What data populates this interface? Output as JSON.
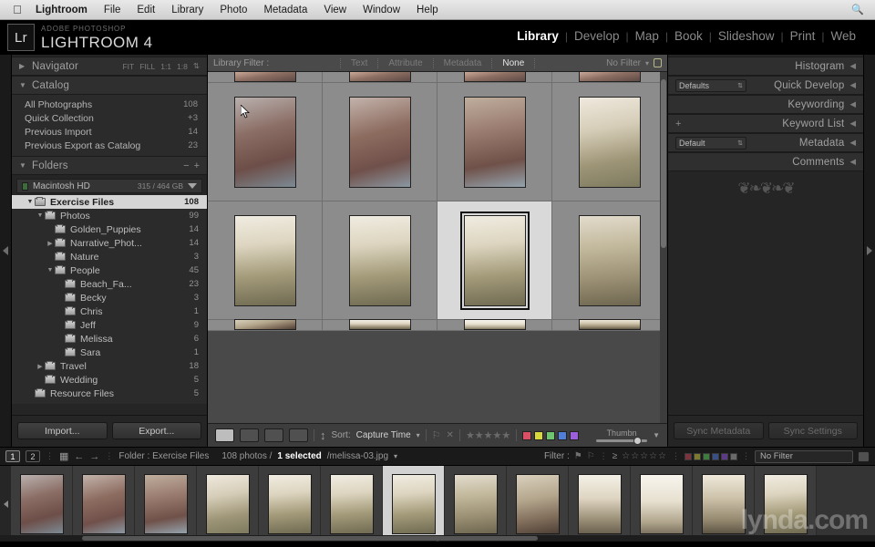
{
  "menubar": {
    "apple": "apple-logo",
    "items": [
      "Lightroom",
      "File",
      "Edit",
      "Library",
      "Photo",
      "Metadata",
      "View",
      "Window",
      "Help"
    ],
    "search": "search-icon"
  },
  "identity": {
    "badge": "Lr",
    "small": "ADOBE PHOTOSHOP",
    "large": "LIGHTROOM 4"
  },
  "modules": {
    "items": [
      "Library",
      "Develop",
      "Map",
      "Book",
      "Slideshow",
      "Print",
      "Web"
    ],
    "active": "Library",
    "separator": "|"
  },
  "left_panel": {
    "navigator": {
      "title": "Navigator",
      "twist": "▶",
      "zoom_options": [
        "FIT",
        "FILL",
        "1:1",
        "1:8"
      ]
    },
    "catalog": {
      "title": "Catalog",
      "twist": "▼",
      "items": [
        {
          "label": "All Photographs",
          "count": "108"
        },
        {
          "label": "Quick Collection",
          "count": "3",
          "plus": "+"
        },
        {
          "label": "Previous Import",
          "count": "14"
        },
        {
          "label": "Previous Export as Catalog",
          "count": "23"
        }
      ]
    },
    "folders": {
      "title": "Folders",
      "twist": "▼",
      "minus": "−",
      "plus": "+",
      "volume": {
        "name": "Macintosh HD",
        "capacity": "315 / 464 GB"
      },
      "tree": [
        {
          "label": "Exercise Files",
          "count": "108",
          "indent": 1,
          "arrow": "▼",
          "selected": true
        },
        {
          "label": "Photos",
          "count": "99",
          "indent": 2,
          "arrow": "▼",
          "selected": false
        },
        {
          "label": "Golden_Puppies",
          "count": "14",
          "indent": 3,
          "arrow": "",
          "selected": false
        },
        {
          "label": "Narrative_Phot...",
          "count": "14",
          "indent": 3,
          "arrow": "▶",
          "selected": false
        },
        {
          "label": "Nature",
          "count": "3",
          "indent": 3,
          "arrow": "",
          "selected": false
        },
        {
          "label": "People",
          "count": "45",
          "indent": 3,
          "arrow": "▼",
          "selected": false
        },
        {
          "label": "Beach_Fa...",
          "count": "23",
          "indent": 4,
          "arrow": "",
          "selected": false
        },
        {
          "label": "Becky",
          "count": "3",
          "indent": 4,
          "arrow": "",
          "selected": false
        },
        {
          "label": "Chris",
          "count": "1",
          "indent": 4,
          "arrow": "",
          "selected": false
        },
        {
          "label": "Jeff",
          "count": "9",
          "indent": 4,
          "arrow": "",
          "selected": false
        },
        {
          "label": "Melissa",
          "count": "6",
          "indent": 4,
          "arrow": "",
          "selected": false
        },
        {
          "label": "Sara",
          "count": "1",
          "indent": 4,
          "arrow": "",
          "selected": false
        },
        {
          "label": "Travel",
          "count": "18",
          "indent": 2,
          "arrow": "▶",
          "selected": false
        },
        {
          "label": "Wedding",
          "count": "5",
          "indent": 2,
          "arrow": "",
          "selected": false
        },
        {
          "label": "Resource Files",
          "count": "5",
          "indent": 1,
          "arrow": "",
          "selected": false
        }
      ]
    },
    "import_label": "Import...",
    "export_label": "Export..."
  },
  "filter_bar": {
    "label": "Library Filter :",
    "tabs": [
      "Text",
      "Attribute",
      "Metadata",
      "None"
    ],
    "active_tab": "None",
    "preset": "No Filter",
    "lock": "lock-icon"
  },
  "right_panel": {
    "sections": [
      {
        "title": "Histogram",
        "control": null
      },
      {
        "title": "Quick Develop",
        "control": "Defaults"
      },
      {
        "title": "Keywording",
        "control": null
      },
      {
        "title": "Keyword List",
        "control": "+"
      },
      {
        "title": "Metadata",
        "control": "Default"
      },
      {
        "title": "Comments",
        "control": null
      }
    ],
    "collapse_arrow": "◀",
    "ornament": "decorative-flourish",
    "sync_metadata_label": "Sync Metadata",
    "sync_settings_label": "Sync Settings"
  },
  "toolbar": {
    "view_icons": [
      "grid-view-icon",
      "loupe-view-icon",
      "compare-view-icon",
      "survey-view-icon"
    ],
    "sort_icon": "sort-az-icon",
    "sort_label": "Sort:",
    "sort_value": "Capture Time",
    "flag_icon": "flag-icon",
    "reject_icon": "reject-icon",
    "stars": "★★★★★",
    "color_labels": [
      "#d94f63",
      "#d8d83c",
      "#6fc46f",
      "#4f7fd9",
      "#9a5fd9"
    ],
    "thumbnail_label": "Thumbn",
    "thumbnail_dropdown": "▼"
  },
  "filmstrip_bar": {
    "page1": "1",
    "page2": "2",
    "grid_icon": "grid-icon",
    "back_arrow": "←",
    "forward_arrow": "→",
    "folder_label": "Folder : Exercise Files",
    "photo_count": "108 photos /",
    "selected_text": "1 selected",
    "filename": "/melissa-03.jpg",
    "filename_caret": "▾",
    "filter_label": "Filter :",
    "flag_icons": [
      "flag-pick-icon",
      "flag-reject-icon"
    ],
    "rating_op": "≥",
    "rating_stars": "☆☆☆☆☆",
    "color_swatches": [
      "#7a3440",
      "#7a7a30",
      "#3f7a3f",
      "#3a4f86",
      "#5d3a86",
      "#6a6a6a"
    ],
    "no_filter": "No Filter",
    "preset_icon": "preset-icon"
  },
  "watermark": "lynda.com",
  "cursor": "arrow-cursor",
  "grid": {
    "columns": 4,
    "rows": [
      {
        "clipped": true,
        "cells": [
          {
            "kind": "portrait-sunset",
            "selected": false
          },
          {
            "kind": "portrait-sunset",
            "selected": false
          },
          {
            "kind": "portrait-sunset",
            "selected": false
          },
          {
            "kind": "portrait-sunset",
            "selected": false
          }
        ]
      },
      {
        "clipped": false,
        "cells": [
          {
            "kind": "girl-brown-shirt",
            "selected": false
          },
          {
            "kind": "girl-brown-shirt-smile",
            "selected": false
          },
          {
            "kind": "girl-brown-looking-down",
            "selected": false
          },
          {
            "kind": "girl-hat-white-jacket",
            "selected": false
          }
        ]
      },
      {
        "clipped": false,
        "cells": [
          {
            "kind": "girl-hat-bridge",
            "selected": false
          },
          {
            "kind": "girl-hat-bridge",
            "selected": false
          },
          {
            "kind": "girl-hat-bridge",
            "selected": true
          },
          {
            "kind": "girl-bridge-sitting",
            "selected": false
          }
        ]
      },
      {
        "clipped": true,
        "cells": [
          {
            "kind": "girl-cap-closeup",
            "selected": false
          },
          {
            "kind": "bridge-sepia",
            "selected": false
          },
          {
            "kind": "bridge-sepia-light",
            "selected": false
          },
          {
            "kind": "bridge-sepia-arch",
            "selected": false
          }
        ]
      }
    ]
  },
  "filmstrip": {
    "thumbs": [
      {
        "kind": "girl-brown-shirt",
        "selected": false
      },
      {
        "kind": "girl-brown-shirt-smile",
        "selected": false
      },
      {
        "kind": "girl-brown-looking-down",
        "selected": false
      },
      {
        "kind": "girl-hat-white-jacket",
        "selected": false
      },
      {
        "kind": "girl-hat-bridge",
        "selected": false
      },
      {
        "kind": "girl-hat-bridge",
        "selected": false
      },
      {
        "kind": "girl-hat-bridge",
        "selected": true
      },
      {
        "kind": "girl-bridge-sitting",
        "selected": false
      },
      {
        "kind": "girl-cap-closeup",
        "selected": false
      },
      {
        "kind": "bridge-sepia",
        "selected": false
      },
      {
        "kind": "bridge-sepia-light",
        "selected": false
      },
      {
        "kind": "bridge-sepia-arch",
        "selected": false
      },
      {
        "kind": "girl-hat-bridge",
        "selected": false
      }
    ]
  }
}
